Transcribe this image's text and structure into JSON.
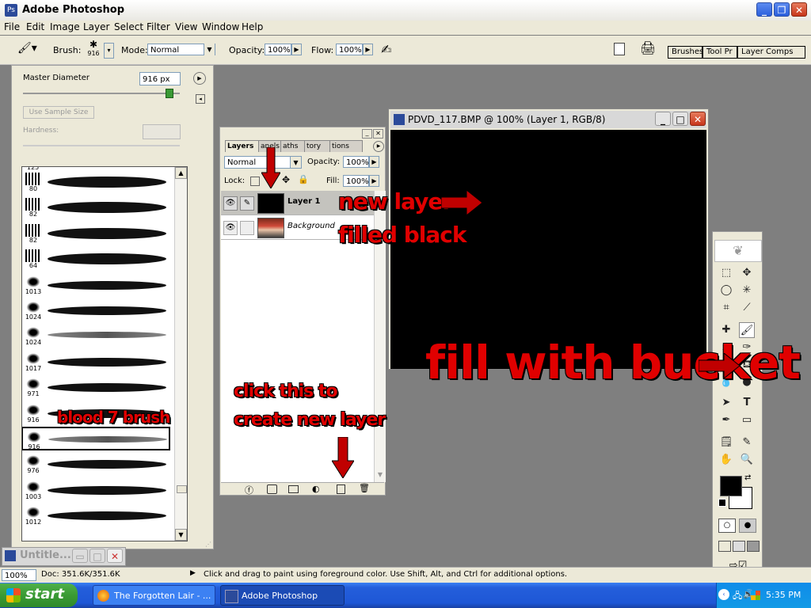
{
  "app": {
    "title": "Adobe Photoshop"
  },
  "menu": [
    "File",
    "Edit",
    "Image",
    "Layer",
    "Select",
    "Filter",
    "View",
    "Window",
    "Help"
  ],
  "options": {
    "brush_label": "Brush:",
    "brush_size": "916",
    "mode_label": "Mode:",
    "mode_value": "Normal",
    "opacity_label": "Opacity:",
    "opacity_value": "100%",
    "flow_label": "Flow:",
    "flow_value": "100%",
    "wells": [
      "Brushes",
      "Tool Pr",
      "Layer Comps"
    ]
  },
  "brush_picker": {
    "master_label": "Master Diameter",
    "master_value": "916 px",
    "master_fraction": 0.93,
    "sample_btn": "Use Sample Size",
    "hardness_label": "Hardness:",
    "top_partial": "125",
    "brushes": [
      {
        "num": "80",
        "style": "hard"
      },
      {
        "num": "82",
        "style": "hard"
      },
      {
        "num": "82",
        "style": "hard"
      },
      {
        "num": "64",
        "style": "hard"
      },
      {
        "num": "1013",
        "style": "splat"
      },
      {
        "num": "1024",
        "style": "splat"
      },
      {
        "num": "1024",
        "style": "soft"
      },
      {
        "num": "1017",
        "style": "splat"
      },
      {
        "num": "971",
        "style": "splat"
      },
      {
        "num": "916",
        "style": "splat"
      },
      {
        "num": "916",
        "style": "soft",
        "selected": true
      },
      {
        "num": "976",
        "style": "splat"
      },
      {
        "num": "1003",
        "style": "splat"
      },
      {
        "num": "1012",
        "style": "splat"
      }
    ]
  },
  "layers_panel": {
    "tabs": [
      "Layers",
      "Channels",
      "Paths",
      "History",
      "Actions"
    ],
    "tab_visible": [
      "Layers",
      "anels",
      "aths",
      "tory",
      "tions"
    ],
    "blend_mode": "Normal",
    "opacity_label": "Opacity:",
    "opacity_value": "100%",
    "lock_label": "Lock:",
    "fill_label": "Fill:",
    "fill_value": "100%",
    "layers": [
      {
        "name": "Layer 1",
        "selected": true
      },
      {
        "name": "Background",
        "selected": false
      }
    ]
  },
  "document": {
    "title": "PDVD_117.BMP @ 100% (Layer 1, RGB/8)"
  },
  "minimized_doc": {
    "title": "Untitle..."
  },
  "annotations": {
    "new_layer": "new layer",
    "filled_black": "filled black",
    "fill_bucket": "fill with bucket",
    "click_this": "click this to",
    "create_layer": "create new layer",
    "blood_brush": "blood 7 brush"
  },
  "statusbar": {
    "zoom": "100%",
    "doc": "Doc: 351.6K/351.6K",
    "hint": "Click and drag to paint using foreground color.  Use Shift, Alt, and Ctrl for additional options."
  },
  "taskbar": {
    "start": "start",
    "items": [
      "The Forgotten Lair - ...",
      "Adobe Photoshop"
    ],
    "clock": "5:35 PM"
  },
  "colors": {
    "annotation": "#e00000",
    "taskbar": "#245edb",
    "canvas": "#000000"
  }
}
